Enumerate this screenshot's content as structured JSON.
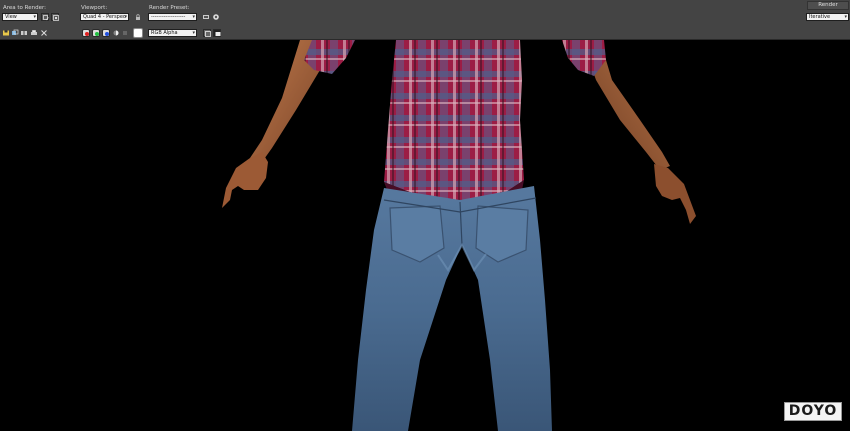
{
  "toolbar": {
    "area_to_render": {
      "label": "Area to Render:",
      "value": "View"
    },
    "viewport": {
      "label": "Viewport:",
      "value": "Quad 4 - Perspec"
    },
    "render_preset": {
      "label": "Render Preset:",
      "value": "-------------------"
    },
    "render": {
      "button_label": "Render",
      "mode": "Iterative"
    },
    "channel_display": {
      "value": "RGB Alpha"
    },
    "channels": [
      {
        "name": "red-channel",
        "color": "#e02020"
      },
      {
        "name": "green-channel",
        "color": "#20c040"
      },
      {
        "name": "blue-channel",
        "color": "#2050e0"
      }
    ]
  },
  "viewport_image": {
    "description": "Back view of 3D character in plaid shirt and blue jeans",
    "background": "#000000",
    "shirt_color": "#a0204a",
    "jeans_color": "#4a6d95",
    "skin_color": "#b07045"
  },
  "watermark": {
    "text": "DOYO"
  }
}
